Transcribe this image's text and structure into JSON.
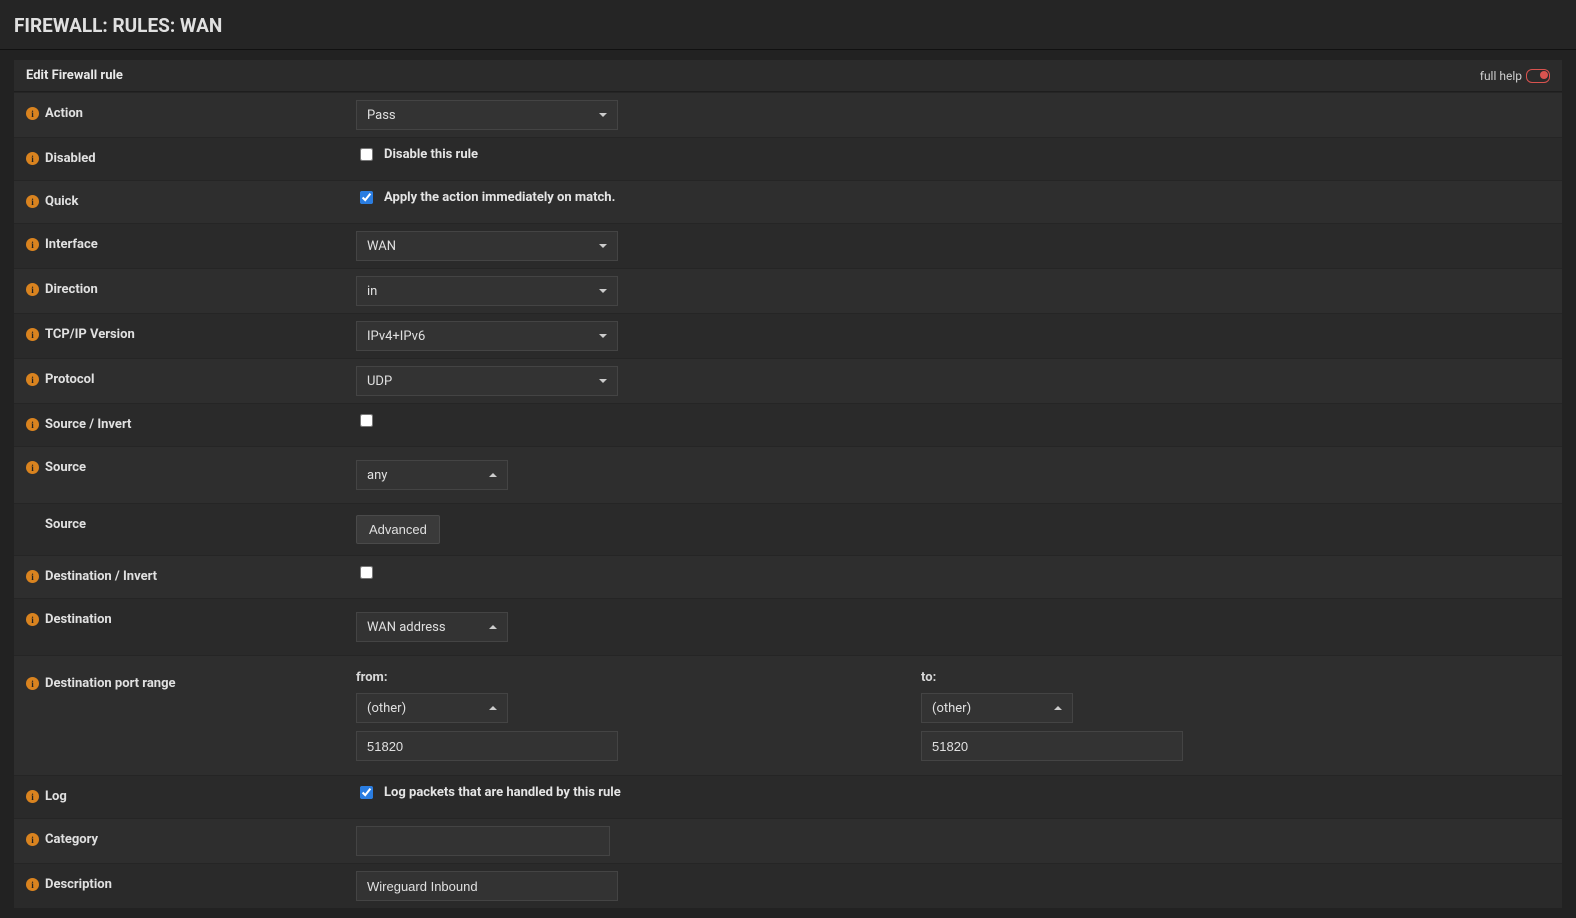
{
  "page_title": "FIREWALL: RULES: WAN",
  "panel_title": "Edit Firewall rule",
  "full_help_label": "full help",
  "rows": {
    "action": {
      "label": "Action",
      "value": "Pass"
    },
    "disabled": {
      "label": "Disabled",
      "chk_label": "Disable this rule"
    },
    "quick": {
      "label": "Quick",
      "chk_label": "Apply the action immediately on match."
    },
    "interface": {
      "label": "Interface",
      "value": "WAN"
    },
    "direction": {
      "label": "Direction",
      "value": "in"
    },
    "tcpip": {
      "label": "TCP/IP Version",
      "value": "IPv4+IPv6"
    },
    "protocol": {
      "label": "Protocol",
      "value": "UDP"
    },
    "source_invert": {
      "label": "Source / Invert"
    },
    "source": {
      "label": "Source",
      "value": "any"
    },
    "source_adv": {
      "label": "Source",
      "button": "Advanced"
    },
    "dest_invert": {
      "label": "Destination / Invert"
    },
    "dest": {
      "label": "Destination",
      "value": "WAN address"
    },
    "dest_port": {
      "label": "Destination port range",
      "from_label": "from:",
      "to_label": "to:",
      "from_sel": "(other)",
      "to_sel": "(other)",
      "from_val": "51820",
      "to_val": "51820"
    },
    "log": {
      "label": "Log",
      "chk_label": "Log packets that are handled by this rule"
    },
    "category": {
      "label": "Category",
      "value": ""
    },
    "description": {
      "label": "Description",
      "value": "Wireguard Inbound"
    }
  }
}
